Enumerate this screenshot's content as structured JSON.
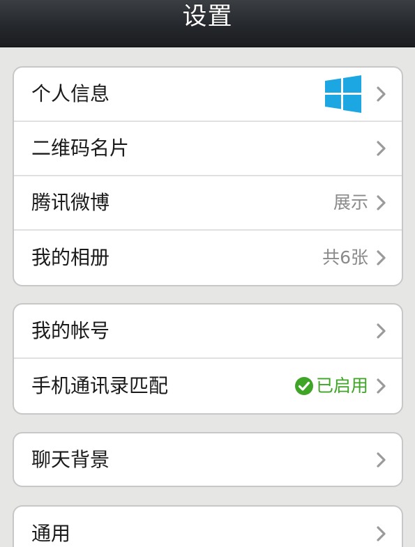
{
  "header": {
    "title": "设置"
  },
  "groups": [
    {
      "rows": [
        {
          "label": "个人信息",
          "icon": "windows-logo-icon",
          "accent": "#1da7e2"
        },
        {
          "label": "二维码名片"
        },
        {
          "label": "腾讯微博",
          "value": "展示"
        },
        {
          "label": "我的相册",
          "value": "共6张"
        }
      ]
    },
    {
      "rows": [
        {
          "label": "我的帐号"
        },
        {
          "label": "手机通讯录匹配",
          "value": "已启用",
          "status_color": "#3fa526",
          "icon": "check-circle-icon"
        }
      ]
    },
    {
      "rows": [
        {
          "label": "聊天背景"
        }
      ]
    },
    {
      "rows": [
        {
          "label": "通用"
        }
      ]
    }
  ],
  "colors": {
    "background": "#e6e6e5",
    "titlebar": "#25282c",
    "value_text": "#8a8a8a",
    "enabled_green": "#3fa526"
  }
}
